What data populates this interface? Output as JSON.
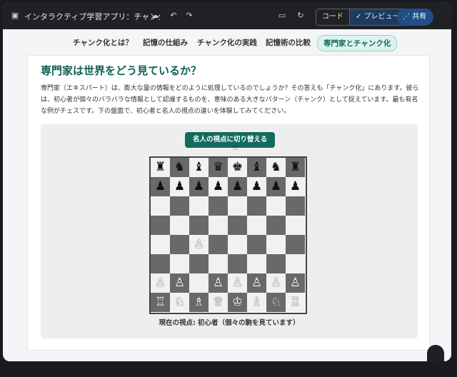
{
  "topbar": {
    "app_title": "インタラクティブ学習アプリ：チャンク化の力",
    "seg_code": "コード",
    "seg_preview": "プレビュー",
    "share": "共有"
  },
  "nav": {
    "items": [
      "チャンク化とは？",
      "記憶の仕組み",
      "チャンク化の実践",
      "記憶術の比較",
      "専門家とチャンク化"
    ]
  },
  "section": {
    "heading": "専門家は世界をどう見ているか？",
    "paragraph": "専門家（エキスパート）は、膨大な量の情報をどのように処理しているのでしょうか？その答えも「チャンク化」にあります。彼らは、初心者が個々のバラバラな情報として認識するものを、意味のある大きなパターン（チャンク）として捉えています。最も有名な例がチェスです。下の盤面で、初心者と名人の視点の違いを体験してみてください。",
    "toggle_button": "名人の視点に切り替える",
    "caption": "現在の視点: 初心者（個々の駒を見ています）"
  },
  "board": {
    "rows": [
      [
        "♜",
        "♞",
        "♝",
        "♛",
        "♚",
        "♝",
        "♞",
        "♜"
      ],
      [
        "♟",
        "♟",
        "♟",
        "♟",
        "♟",
        "♟",
        "♟",
        "♟"
      ],
      [
        "",
        "",
        "",
        "",
        "",
        "",
        "",
        ""
      ],
      [
        "",
        "",
        "",
        "",
        "",
        "",
        "",
        ""
      ],
      [
        "",
        "",
        "♙",
        "",
        "",
        "",
        "",
        ""
      ],
      [
        "",
        "",
        "",
        "",
        "",
        "",
        "",
        ""
      ],
      [
        "♙",
        "♙",
        "",
        "♙",
        "♙",
        "♙",
        "♙",
        "♙"
      ],
      [
        "♖",
        "♘",
        "♗",
        "♕",
        "♔",
        "♗",
        "♘",
        "♖"
      ]
    ]
  }
}
